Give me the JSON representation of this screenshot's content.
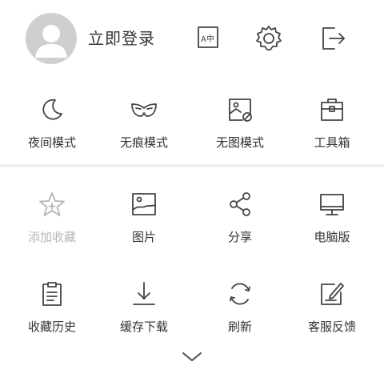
{
  "header": {
    "login_label": "立即登录",
    "translate_icon_text": "A中",
    "icons": [
      "user-avatar-icon",
      "translate-icon",
      "gear-icon",
      "exit-icon"
    ]
  },
  "menu": {
    "row1": [
      {
        "label": "夜间模式",
        "icon": "moon-icon"
      },
      {
        "label": "无痕模式",
        "icon": "mask-icon"
      },
      {
        "label": "无图模式",
        "icon": "no-image-icon"
      },
      {
        "label": "工具箱",
        "icon": "toolbox-icon"
      }
    ],
    "row2": [
      {
        "label": "添加收藏",
        "icon": "star-add-icon",
        "disabled": true
      },
      {
        "label": "图片",
        "icon": "image-icon"
      },
      {
        "label": "分享",
        "icon": "share-icon"
      },
      {
        "label": "电脑版",
        "icon": "desktop-icon"
      }
    ],
    "row3": [
      {
        "label": "收藏历史",
        "icon": "clipboard-icon"
      },
      {
        "label": "缓存下载",
        "icon": "download-icon"
      },
      {
        "label": "刷新",
        "icon": "refresh-icon"
      },
      {
        "label": "客服反馈",
        "icon": "feedback-edit-icon"
      }
    ]
  },
  "footer": {
    "icon": "chevron-down-icon"
  },
  "colors": {
    "icon_stroke": "#444444",
    "text": "#333333",
    "disabled": "#b5b5b5",
    "avatar_bg": "#cfcfcf",
    "divider": "#efefef"
  }
}
